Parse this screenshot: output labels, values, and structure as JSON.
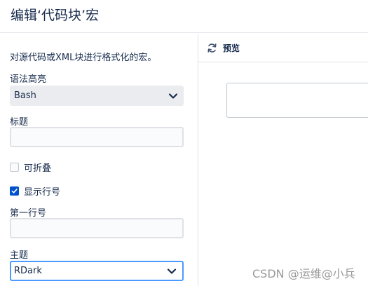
{
  "dialog": {
    "title": "编辑‘代码块’宏"
  },
  "form": {
    "description": "对源代码或XML块进行格式化的宏。",
    "language": {
      "label": "语法高亮",
      "value": "Bash"
    },
    "title_field": {
      "label": "标题",
      "value": ""
    },
    "collapsible": {
      "label": "可折叠",
      "checked": false
    },
    "line_numbers": {
      "label": "显示行号",
      "checked": true
    },
    "first_line": {
      "label": "第一行号",
      "value": ""
    },
    "theme": {
      "label": "主题",
      "value": "RDark"
    }
  },
  "preview": {
    "label": "预览",
    "icon": "refresh-icon"
  },
  "watermark": "CSDN @运维@小兵",
  "colors": {
    "accent": "#0052cc",
    "focus": "#4c9aff",
    "select_bg": "#ebecf0"
  }
}
